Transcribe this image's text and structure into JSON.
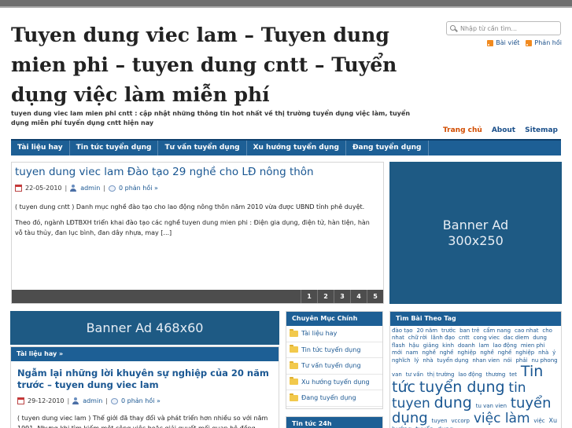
{
  "site": {
    "title": "Tuyen dung viec lam – Tuyen dung mien phi – tuyen dung cntt – Tuyển dụng việc làm miễn phí",
    "tagline": "tuyen dung viec lam mien phi cntt : cập nhật những thông tin hot nhất về thị trường tuyển dụng việc làm, tuyển dụng miễn phí tuyển dụng cntt hiện nay"
  },
  "search": {
    "placeholder": "Nhập từ cần tìm..."
  },
  "feeds": {
    "posts": "Bài viết",
    "comments": "Phản hồi"
  },
  "toplinks": {
    "home": "Trang chủ",
    "about": "About",
    "sitemap": "Sitemap"
  },
  "nav": [
    "Tài liệu hay",
    "Tin tức tuyển dụng",
    "Tư vấn tuyển dụng",
    "Xu hướng tuyển dụng",
    "Đang tuyển dụng"
  ],
  "featured": {
    "title": "tuyen dung viec lam Đào tạo 29 nghề cho LĐ nông thôn",
    "date": "22-05-2010",
    "author": "admin",
    "comments": "0 phản hồi »",
    "para1": "( tuyen dung cntt ) Danh mục nghề đào tạo cho lao động nông thôn năm 2010 vừa được UBND tỉnh phê duyệt.",
    "para2": "Theo đó, ngành LĐTBXH triển khai đào tạo các nghề  tuyen dung mien phi : Điện gia dụng, điện tử, hàn tiện, hàn vỗ tàu thủy, đan lục bình, đan dây nhựa, may [...]",
    "pages": [
      "1",
      "2",
      "3",
      "4",
      "5"
    ]
  },
  "ad300": {
    "line1": "Banner Ad",
    "line2": "300x250"
  },
  "ad468": {
    "text": "Banner Ad 468x60"
  },
  "section": {
    "header": "Tài liệu hay »",
    "title": "Ngẫm lại những lời khuyên sự nghiệp của 20 năm trước – tuyen dung viec lam",
    "date": "29-12-2010",
    "author": "admin",
    "comments": "0 phản hồi »",
    "para1": "( tuyen dung viec lam ) Thế giới đã thay đổi và phát triển hơn nhiều so với năm 1991. Nhưng khi tìm kiếm một công việc hoặc giải quyết mối quan hệ đồng"
  },
  "categories": {
    "header": "Chuyên Mục Chính",
    "items": [
      "Tài liệu hay",
      "Tin tức tuyển dụng",
      "Tư vấn tuyển dụng",
      "Xu hướng tuyển dụng",
      "Đang tuyển dụng"
    ]
  },
  "news": {
    "header": "Tin tức 24h"
  },
  "tags": {
    "header": "Tìm Bài Theo Tag",
    "cloud": [
      {
        "t": "đào tạo",
        "s": 7
      },
      {
        "t": "20 năm",
        "s": 7
      },
      {
        "t": "trước",
        "s": 7
      },
      {
        "t": "ban trẻ",
        "s": 7
      },
      {
        "t": "cẩm nang",
        "s": 7
      },
      {
        "t": "cao nhat",
        "s": 7
      },
      {
        "t": "cho nhat",
        "s": 7
      },
      {
        "t": "chữ rời",
        "s": 7
      },
      {
        "t": "lãnh đạo",
        "s": 7
      },
      {
        "t": "cntt",
        "s": 7
      },
      {
        "t": "cong viec",
        "s": 7
      },
      {
        "t": "dac diem",
        "s": 7
      },
      {
        "t": "dung",
        "s": 7
      },
      {
        "t": "flash",
        "s": 7
      },
      {
        "t": "hậu",
        "s": 7
      },
      {
        "t": "giảng",
        "s": 7
      },
      {
        "t": "kinh",
        "s": 7
      },
      {
        "t": "doanh",
        "s": 7
      },
      {
        "t": "lam",
        "s": 7
      },
      {
        "t": "lao động",
        "s": 7
      },
      {
        "t": "mien phi",
        "s": 7
      },
      {
        "t": "mới",
        "s": 7
      },
      {
        "t": "nam",
        "s": 7
      },
      {
        "t": "nghề",
        "s": 7
      },
      {
        "t": "nghề",
        "s": 7
      },
      {
        "t": "nghiệp",
        "s": 7
      },
      {
        "t": "nghề",
        "s": 7
      },
      {
        "t": "nghề",
        "s": 7
      },
      {
        "t": "nghiệp",
        "s": 7
      },
      {
        "t": "nhà",
        "s": 7
      },
      {
        "t": "ý nghĩch",
        "s": 7
      },
      {
        "t": "lý",
        "s": 7
      },
      {
        "t": "nhà",
        "s": 7
      },
      {
        "t": "tuyển dụng",
        "s": 7
      },
      {
        "t": "nhan vien",
        "s": 7
      },
      {
        "t": "nói",
        "s": 7
      },
      {
        "t": "phải",
        "s": 7
      },
      {
        "t": "nu phong",
        "s": 7
      },
      {
        "t": "van",
        "s": 7
      },
      {
        "t": "tư vấn",
        "s": 7
      },
      {
        "t": "thị trường",
        "s": 7
      },
      {
        "t": "lao động",
        "s": 7
      },
      {
        "t": "thương",
        "s": 7
      },
      {
        "t": "tet",
        "s": 7
      },
      {
        "t": "Tin tức",
        "s": 19
      },
      {
        "t": "tuyển dụng",
        "s": 19
      },
      {
        "t": "tin tuyen",
        "s": 17
      },
      {
        "t": "dung",
        "s": 19
      },
      {
        "t": "tu van vien",
        "s": 7
      },
      {
        "t": "tuyển dụng",
        "s": 18
      },
      {
        "t": "tuyen",
        "s": 7
      },
      {
        "t": "vccorp",
        "s": 7
      },
      {
        "t": "việc làm",
        "s": 17
      },
      {
        "t": "việc",
        "s": 7
      },
      {
        "t": "Xu hướng",
        "s": 8
      },
      {
        "t": "tuyển",
        "s": 8
      },
      {
        "t": "dụng",
        "s": 8
      }
    ]
  }
}
